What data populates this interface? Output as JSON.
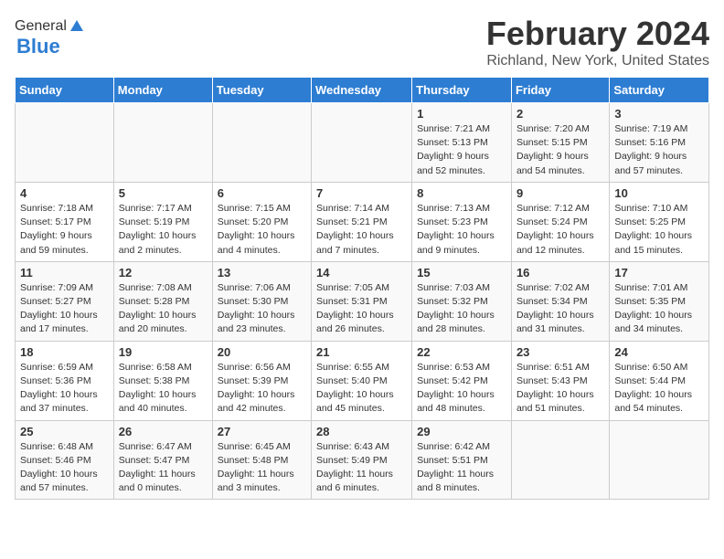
{
  "logo": {
    "general": "General",
    "blue": "Blue"
  },
  "title": "February 2024",
  "subtitle": "Richland, New York, United States",
  "headers": [
    "Sunday",
    "Monday",
    "Tuesday",
    "Wednesday",
    "Thursday",
    "Friday",
    "Saturday"
  ],
  "rows": [
    [
      {
        "day": "",
        "info": ""
      },
      {
        "day": "",
        "info": ""
      },
      {
        "day": "",
        "info": ""
      },
      {
        "day": "",
        "info": ""
      },
      {
        "day": "1",
        "info": "Sunrise: 7:21 AM\nSunset: 5:13 PM\nDaylight: 9 hours\nand 52 minutes."
      },
      {
        "day": "2",
        "info": "Sunrise: 7:20 AM\nSunset: 5:15 PM\nDaylight: 9 hours\nand 54 minutes."
      },
      {
        "day": "3",
        "info": "Sunrise: 7:19 AM\nSunset: 5:16 PM\nDaylight: 9 hours\nand 57 minutes."
      }
    ],
    [
      {
        "day": "4",
        "info": "Sunrise: 7:18 AM\nSunset: 5:17 PM\nDaylight: 9 hours\nand 59 minutes."
      },
      {
        "day": "5",
        "info": "Sunrise: 7:17 AM\nSunset: 5:19 PM\nDaylight: 10 hours\nand 2 minutes."
      },
      {
        "day": "6",
        "info": "Sunrise: 7:15 AM\nSunset: 5:20 PM\nDaylight: 10 hours\nand 4 minutes."
      },
      {
        "day": "7",
        "info": "Sunrise: 7:14 AM\nSunset: 5:21 PM\nDaylight: 10 hours\nand 7 minutes."
      },
      {
        "day": "8",
        "info": "Sunrise: 7:13 AM\nSunset: 5:23 PM\nDaylight: 10 hours\nand 9 minutes."
      },
      {
        "day": "9",
        "info": "Sunrise: 7:12 AM\nSunset: 5:24 PM\nDaylight: 10 hours\nand 12 minutes."
      },
      {
        "day": "10",
        "info": "Sunrise: 7:10 AM\nSunset: 5:25 PM\nDaylight: 10 hours\nand 15 minutes."
      }
    ],
    [
      {
        "day": "11",
        "info": "Sunrise: 7:09 AM\nSunset: 5:27 PM\nDaylight: 10 hours\nand 17 minutes."
      },
      {
        "day": "12",
        "info": "Sunrise: 7:08 AM\nSunset: 5:28 PM\nDaylight: 10 hours\nand 20 minutes."
      },
      {
        "day": "13",
        "info": "Sunrise: 7:06 AM\nSunset: 5:30 PM\nDaylight: 10 hours\nand 23 minutes."
      },
      {
        "day": "14",
        "info": "Sunrise: 7:05 AM\nSunset: 5:31 PM\nDaylight: 10 hours\nand 26 minutes."
      },
      {
        "day": "15",
        "info": "Sunrise: 7:03 AM\nSunset: 5:32 PM\nDaylight: 10 hours\nand 28 minutes."
      },
      {
        "day": "16",
        "info": "Sunrise: 7:02 AM\nSunset: 5:34 PM\nDaylight: 10 hours\nand 31 minutes."
      },
      {
        "day": "17",
        "info": "Sunrise: 7:01 AM\nSunset: 5:35 PM\nDaylight: 10 hours\nand 34 minutes."
      }
    ],
    [
      {
        "day": "18",
        "info": "Sunrise: 6:59 AM\nSunset: 5:36 PM\nDaylight: 10 hours\nand 37 minutes."
      },
      {
        "day": "19",
        "info": "Sunrise: 6:58 AM\nSunset: 5:38 PM\nDaylight: 10 hours\nand 40 minutes."
      },
      {
        "day": "20",
        "info": "Sunrise: 6:56 AM\nSunset: 5:39 PM\nDaylight: 10 hours\nand 42 minutes."
      },
      {
        "day": "21",
        "info": "Sunrise: 6:55 AM\nSunset: 5:40 PM\nDaylight: 10 hours\nand 45 minutes."
      },
      {
        "day": "22",
        "info": "Sunrise: 6:53 AM\nSunset: 5:42 PM\nDaylight: 10 hours\nand 48 minutes."
      },
      {
        "day": "23",
        "info": "Sunrise: 6:51 AM\nSunset: 5:43 PM\nDaylight: 10 hours\nand 51 minutes."
      },
      {
        "day": "24",
        "info": "Sunrise: 6:50 AM\nSunset: 5:44 PM\nDaylight: 10 hours\nand 54 minutes."
      }
    ],
    [
      {
        "day": "25",
        "info": "Sunrise: 6:48 AM\nSunset: 5:46 PM\nDaylight: 10 hours\nand 57 minutes."
      },
      {
        "day": "26",
        "info": "Sunrise: 6:47 AM\nSunset: 5:47 PM\nDaylight: 11 hours\nand 0 minutes."
      },
      {
        "day": "27",
        "info": "Sunrise: 6:45 AM\nSunset: 5:48 PM\nDaylight: 11 hours\nand 3 minutes."
      },
      {
        "day": "28",
        "info": "Sunrise: 6:43 AM\nSunset: 5:49 PM\nDaylight: 11 hours\nand 6 minutes."
      },
      {
        "day": "29",
        "info": "Sunrise: 6:42 AM\nSunset: 5:51 PM\nDaylight: 11 hours\nand 8 minutes."
      },
      {
        "day": "",
        "info": ""
      },
      {
        "day": "",
        "info": ""
      }
    ]
  ]
}
